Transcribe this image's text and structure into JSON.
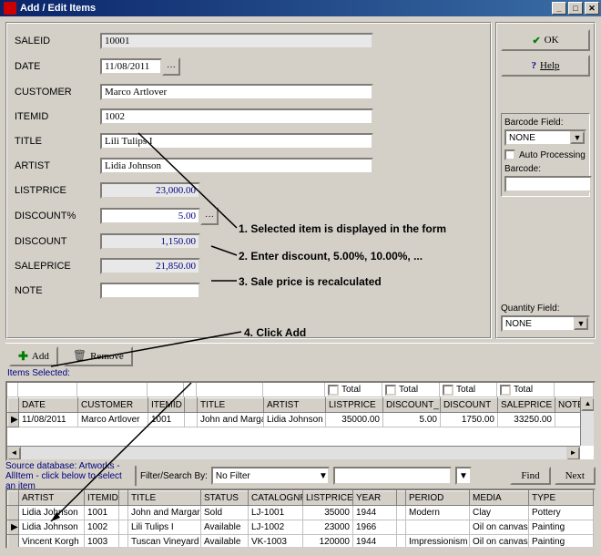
{
  "window": {
    "title": "Add / Edit Items"
  },
  "form": {
    "saleid": {
      "label": "SALEID",
      "value": "10001"
    },
    "date": {
      "label": "DATE",
      "value": "11/08/2011"
    },
    "customer": {
      "label": "CUSTOMER",
      "value": "Marco Artlover"
    },
    "itemid": {
      "label": "ITEMID",
      "value": "1002"
    },
    "title": {
      "label": "TITLE",
      "value": "Lili Tulips I"
    },
    "artist": {
      "label": "ARTIST",
      "value": "Lidia Johnson"
    },
    "listprice": {
      "label": "LISTPRICE",
      "value": "23,000.00"
    },
    "discountpct": {
      "label": "DISCOUNT%",
      "value": "5.00"
    },
    "discount": {
      "label": "DISCOUNT",
      "value": "1,150.00"
    },
    "saleprice": {
      "label": "SALEPRICE",
      "value": "21,850.00"
    },
    "note": {
      "label": "NOTE",
      "value": ""
    }
  },
  "side": {
    "ok": "OK",
    "help": "Help",
    "barcode_label": "Barcode Field:",
    "barcode_value": "NONE",
    "auto_processing": "Auto Processing",
    "barcode2_label": "Barcode:",
    "qty_label": "Quantity Field:",
    "qty_value": "NONE"
  },
  "toolbar": {
    "add": "Add",
    "remove": "Remove"
  },
  "grid1": {
    "label": "Items Selected:",
    "total_label": "Total",
    "columns": [
      "DATE",
      "CUSTOMER",
      "ITEMID",
      "",
      "TITLE",
      "ARTIST",
      "LISTPRICE",
      "DISCOUNT_",
      "DISCOUNT",
      "SALEPRICE",
      "NOTE"
    ],
    "rows": [
      {
        "date": "11/08/2011",
        "customer": "Marco Artlover",
        "itemid": "1001",
        "blank": "",
        "title": "John and Margai",
        "artist": "Lidia Johnson",
        "listprice": "35000.00",
        "discountpct": "5.00",
        "discount": "1750.00",
        "saleprice": "33250.00",
        "note": ""
      }
    ]
  },
  "srcbar": {
    "info": "Source database: Artworks - AllItem - click below to select an item",
    "filter_label": "Filter/Search By:",
    "filter_value": "No Filter",
    "find": "Find",
    "next": "Next"
  },
  "grid2": {
    "columns": [
      "ARTIST",
      "ITEMID",
      "",
      "TITLE",
      "STATUS",
      "CATALOGNR",
      "LISTPRICE",
      "YEAR",
      "",
      "PERIOD",
      "MEDIA",
      "TYPE"
    ],
    "rows": [
      {
        "artist": "Lidia Johnson",
        "itemid": "1001",
        "title": "John and Margar",
        "status": "Sold",
        "catalog": "LJ-1001",
        "listprice": "35000",
        "year": "1944",
        "period": "Modern",
        "media": "Clay",
        "type": "Pottery"
      },
      {
        "artist": "Lidia Johnson",
        "itemid": "1002",
        "title": "Lili Tulips I",
        "status": "Available",
        "catalog": "LJ-1002",
        "listprice": "23000",
        "year": "1966",
        "period": "",
        "media": "Oil on canvas",
        "type": "Painting"
      },
      {
        "artist": "Vincent Korgh",
        "itemid": "1003",
        "title": "Tuscan Vineyard",
        "status": "Available",
        "catalog": "VK-1003",
        "listprice": "120000",
        "year": "1944",
        "period": "Impressionism",
        "media": "Oil on canvas",
        "type": "Painting"
      }
    ]
  },
  "annotations": {
    "a1": "1. Selected item is displayed in the form",
    "a2": "2. Enter discount, 5.00%, 10.00%, ...",
    "a3": "3. Sale price is recalculated",
    "a4": "4. Click Add"
  }
}
